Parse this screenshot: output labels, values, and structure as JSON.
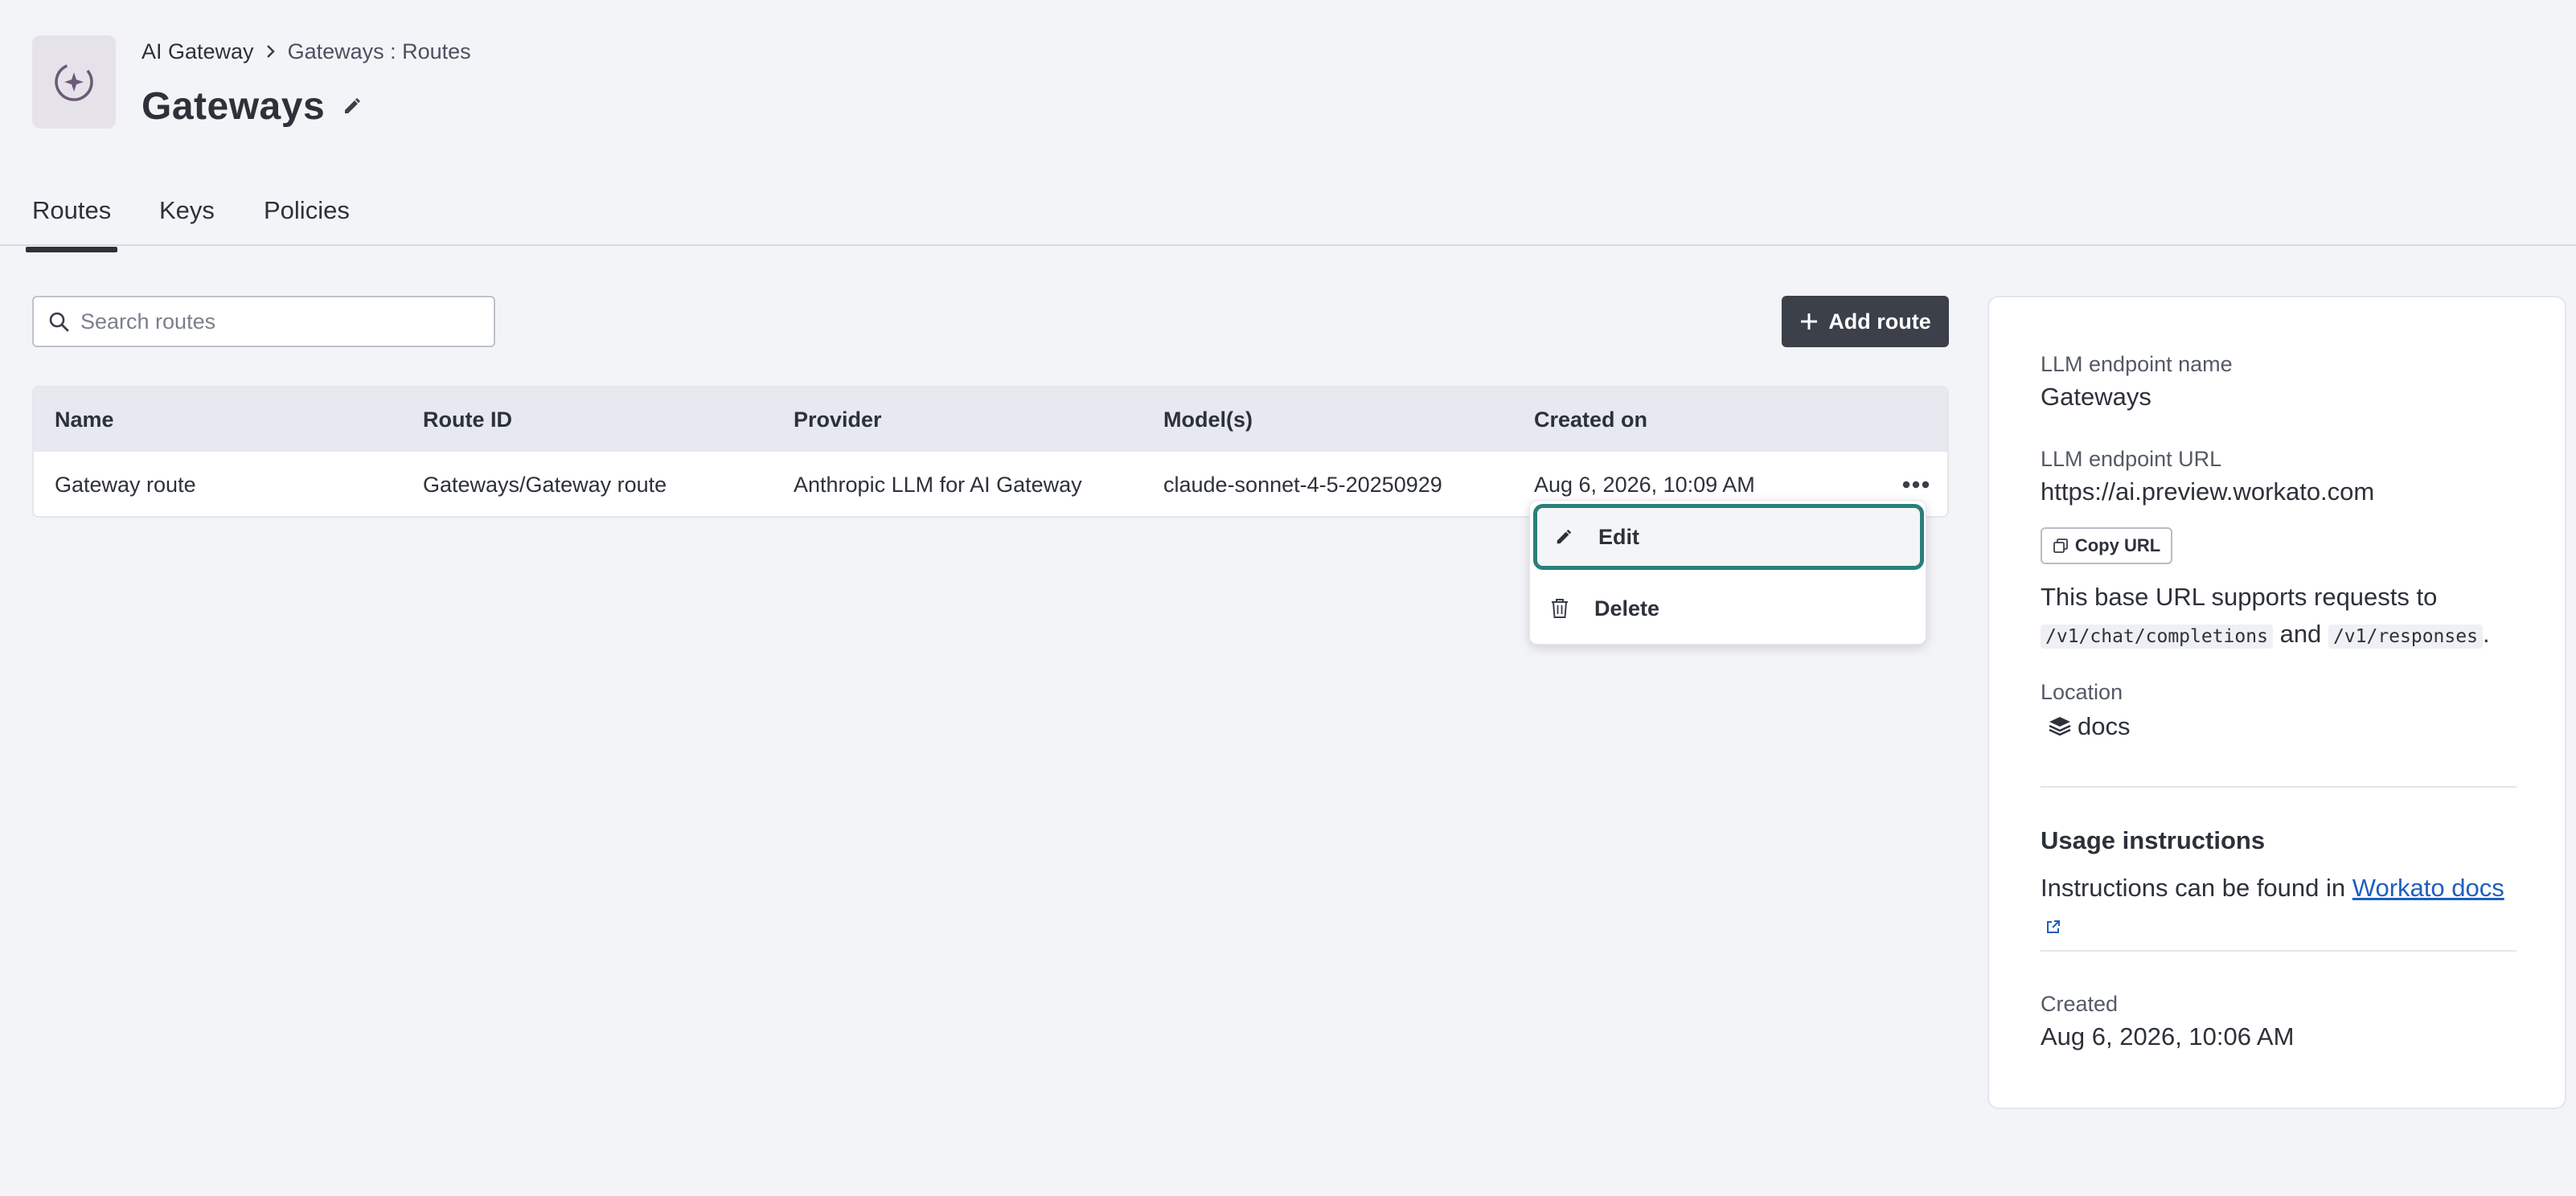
{
  "header": {
    "breadcrumb": {
      "root": "AI Gateway",
      "current": "Gateways : Routes"
    },
    "title": "Gateways"
  },
  "tabs": [
    {
      "label": "Routes",
      "active": true
    },
    {
      "label": "Keys",
      "active": false
    },
    {
      "label": "Policies",
      "active": false
    }
  ],
  "toolbar": {
    "search_placeholder": "Search routes",
    "add_route_label": "Add route"
  },
  "table": {
    "columns": [
      "Name",
      "Route ID",
      "Provider",
      "Model(s)",
      "Created on"
    ],
    "rows": [
      {
        "name": "Gateway route",
        "route_id": "Gateways/Gateway route",
        "provider": "Anthropic LLM for AI Gateway",
        "models": "claude-sonnet-4-5-20250929",
        "created_on": "Aug 6, 2026, 10:09 AM"
      }
    ]
  },
  "row_menu": {
    "edit_label": "Edit",
    "delete_label": "Delete"
  },
  "panel": {
    "endpoint_name_label": "LLM endpoint name",
    "endpoint_name": "Gateways",
    "endpoint_url_label": "LLM endpoint URL",
    "endpoint_url": "https://ai.preview.workato.com",
    "copy_url_label": "Copy URL",
    "base_url_text": "This base URL supports requests to",
    "path_chat": "/v1/chat/completions",
    "and_text": "and",
    "path_responses": "/v1/responses",
    "period": ".",
    "location_label": "Location",
    "location_value": "docs",
    "usage_heading": "Usage instructions",
    "usage_text": "Instructions can be found in",
    "usage_link": "Workato docs",
    "created_label": "Created",
    "created_value": "Aug 6, 2026, 10:06 AM"
  },
  "colors": {
    "accent_focus": "#2a7f7a",
    "primary_button": "#3b4049",
    "link": "#1f5fbf"
  },
  "icons": [
    "ai-gateway-sparkle-icon",
    "chevron-right-icon",
    "pencil-icon",
    "search-icon",
    "plus-icon",
    "more-horizontal-icon",
    "trash-icon",
    "copy-icon",
    "stack-icon",
    "external-link-icon"
  ]
}
